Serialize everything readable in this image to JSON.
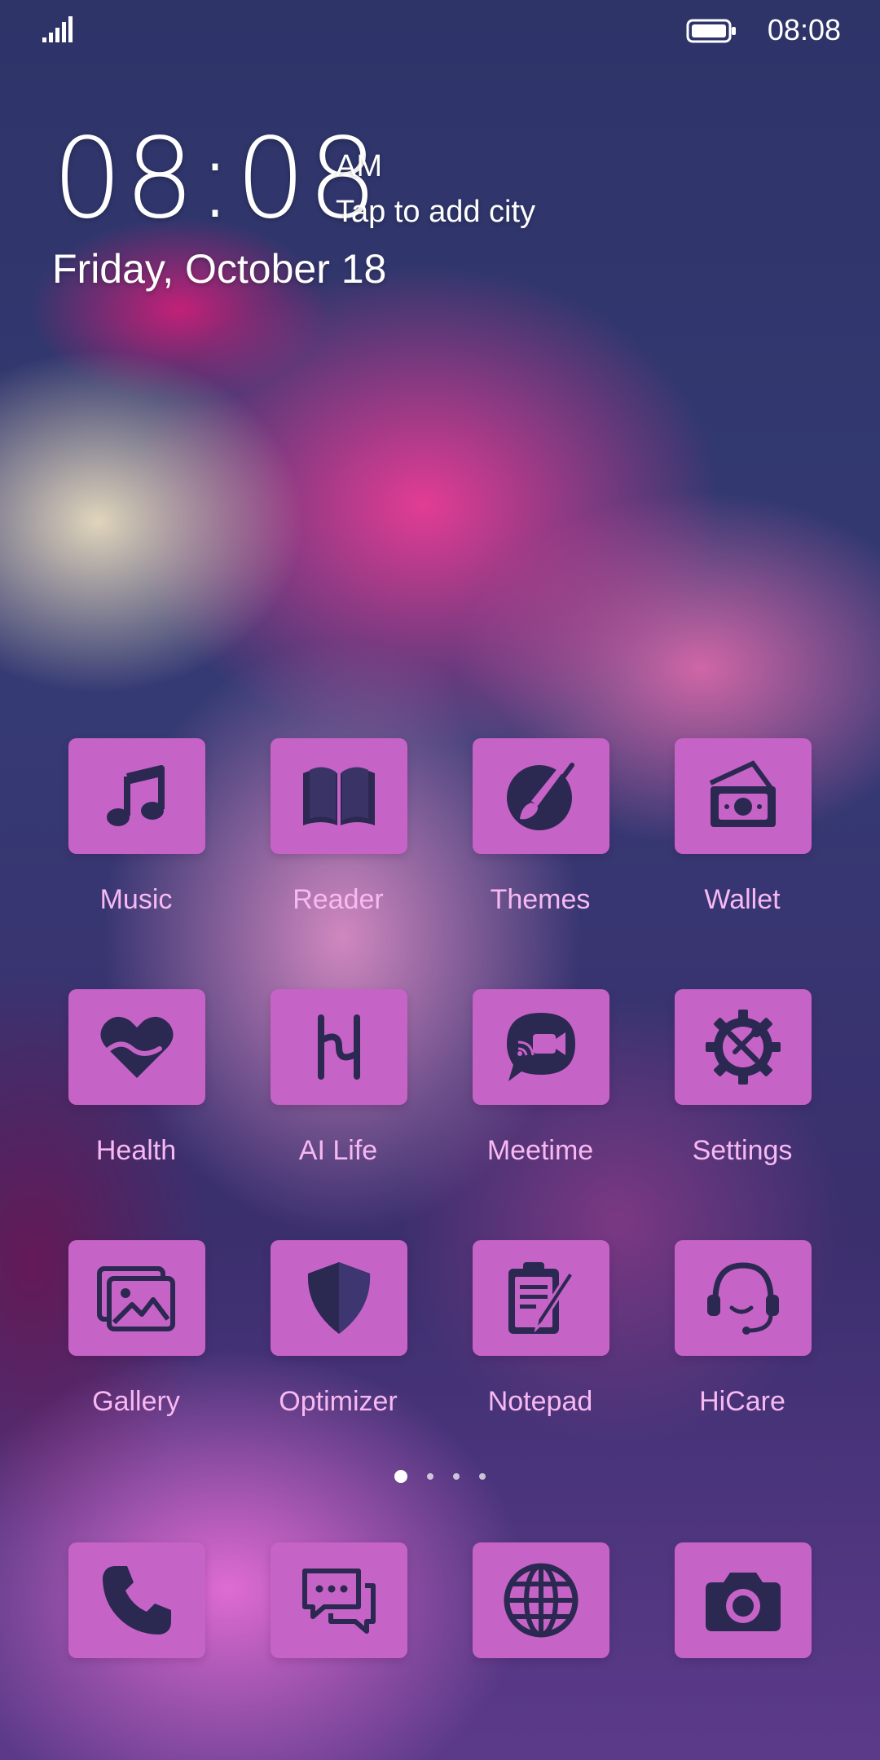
{
  "status_bar": {
    "time": "08:08",
    "signal_icon": "signal-bars-icon",
    "battery_icon": "battery-full-icon"
  },
  "clock_widget": {
    "time": "08:08",
    "ampm": "AM",
    "city_prompt": "Tap to add city",
    "date": "Friday, October 18"
  },
  "apps": [
    {
      "label": "Music",
      "icon": "music-note-icon"
    },
    {
      "label": "Reader",
      "icon": "book-icon"
    },
    {
      "label": "Themes",
      "icon": "paintbrush-icon"
    },
    {
      "label": "Wallet",
      "icon": "wallet-icon"
    },
    {
      "label": "Health",
      "icon": "heart-icon"
    },
    {
      "label": "AI Life",
      "icon": "ai-life-icon"
    },
    {
      "label": "Meetime",
      "icon": "video-chat-icon"
    },
    {
      "label": "Settings",
      "icon": "gear-tools-icon"
    },
    {
      "label": "Gallery",
      "icon": "gallery-icon"
    },
    {
      "label": "Optimizer",
      "icon": "shield-icon"
    },
    {
      "label": "Notepad",
      "icon": "clipboard-pencil-icon"
    },
    {
      "label": "HiCare",
      "icon": "headset-icon"
    }
  ],
  "page_indicator": {
    "pages": 4,
    "current": 1
  },
  "dock": [
    {
      "icon": "phone-icon"
    },
    {
      "icon": "messages-icon"
    },
    {
      "icon": "globe-icon"
    },
    {
      "icon": "camera-icon"
    }
  ],
  "colors": {
    "tile": "#c663c6",
    "icon_glyph": "#2b2852",
    "label": "#f8b9f2",
    "clock_text": "#ffffff"
  }
}
